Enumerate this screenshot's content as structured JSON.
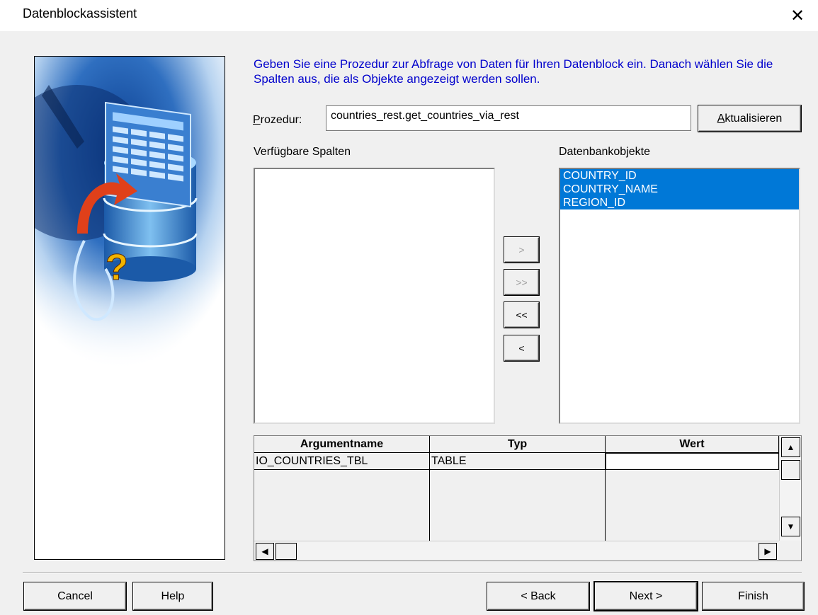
{
  "window": {
    "title": "Datenblockassistent",
    "close_glyph": "✕"
  },
  "instruction": "Geben Sie eine Prozedur zur Abfrage von Daten für Ihren Datenblock ein. Danach wählen Sie die Spalten aus, die als Objekte angezeigt werden sollen.",
  "procedure": {
    "label_prefix": "P",
    "label_rest": "rozedur:",
    "value": "countries_rest.get_countries_via_rest"
  },
  "refresh_button": {
    "prefix": "A",
    "rest": "ktualisieren"
  },
  "available_columns": {
    "label": "Verfügbare Spalten",
    "items": []
  },
  "database_objects": {
    "label": "Datenbankobjekte",
    "items": [
      "COUNTRY_ID",
      "COUNTRY_NAME",
      "REGION_ID"
    ]
  },
  "move_buttons": {
    "add_one": ">",
    "add_all": ">>",
    "remove_all": "<<",
    "remove_one": "<"
  },
  "arguments_grid": {
    "headers": [
      "Argumentname",
      "Typ",
      "Wert"
    ],
    "rows": [
      {
        "name": "IO_COUNTRIES_TBL",
        "type": "TABLE",
        "value": ""
      }
    ]
  },
  "footer": {
    "cancel": "Cancel",
    "help": "Help",
    "back": "< Back",
    "next": "Next >",
    "finish": "Finish"
  },
  "icons": [
    "close-icon",
    "wizard-illustration",
    "scroll-up-icon",
    "scroll-down-icon",
    "scroll-left-icon",
    "scroll-right-icon"
  ],
  "colors": {
    "instruction_text": "#0000cc",
    "selection": "#0078d7"
  }
}
